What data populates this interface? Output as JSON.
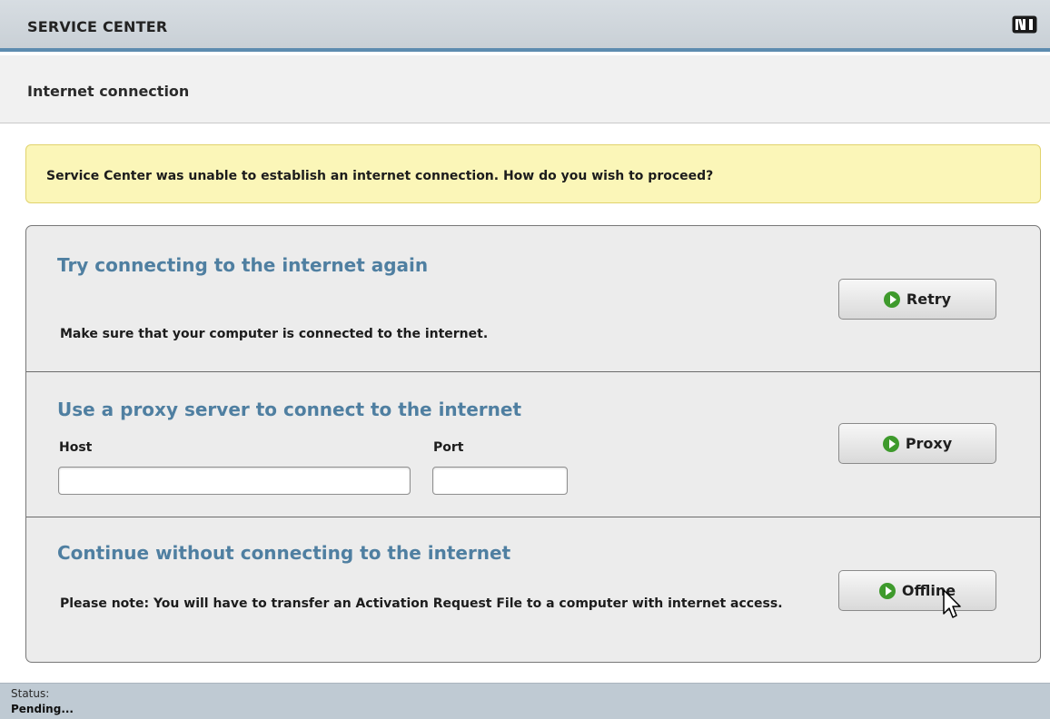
{
  "window": {
    "title": "SERVICE CENTER",
    "logo_icon": "native-instruments-logo-icon"
  },
  "page": {
    "subtitle": "Internet connection"
  },
  "notice": {
    "message": "Service Center was unable to establish an internet connection. How do you wish to proceed?",
    "background_color": "#fbf6b8"
  },
  "options": {
    "retry": {
      "heading": "Try connecting to the internet again",
      "description": "Make sure that your computer is connected to the internet.",
      "button_label": "Retry",
      "button_icon": "play-arrow-icon"
    },
    "proxy": {
      "heading": "Use a proxy server to connect to the internet",
      "host_label": "Host",
      "host_value": "",
      "port_label": "Port",
      "port_value": "",
      "button_label": "Proxy",
      "button_icon": "play-arrow-icon"
    },
    "offline": {
      "heading": "Continue without connecting to the internet",
      "description": "Please note: You will have to transfer an Activation Request File to a computer with internet access.",
      "button_label": "Offline",
      "button_icon": "play-arrow-icon"
    }
  },
  "status": {
    "label": "Status:",
    "value": "Pending..."
  },
  "colors": {
    "accent": "#5d8caf",
    "heading": "#4f7fa1",
    "play_icon": "#3e9a2c",
    "status_bar": "#bfcad3"
  }
}
